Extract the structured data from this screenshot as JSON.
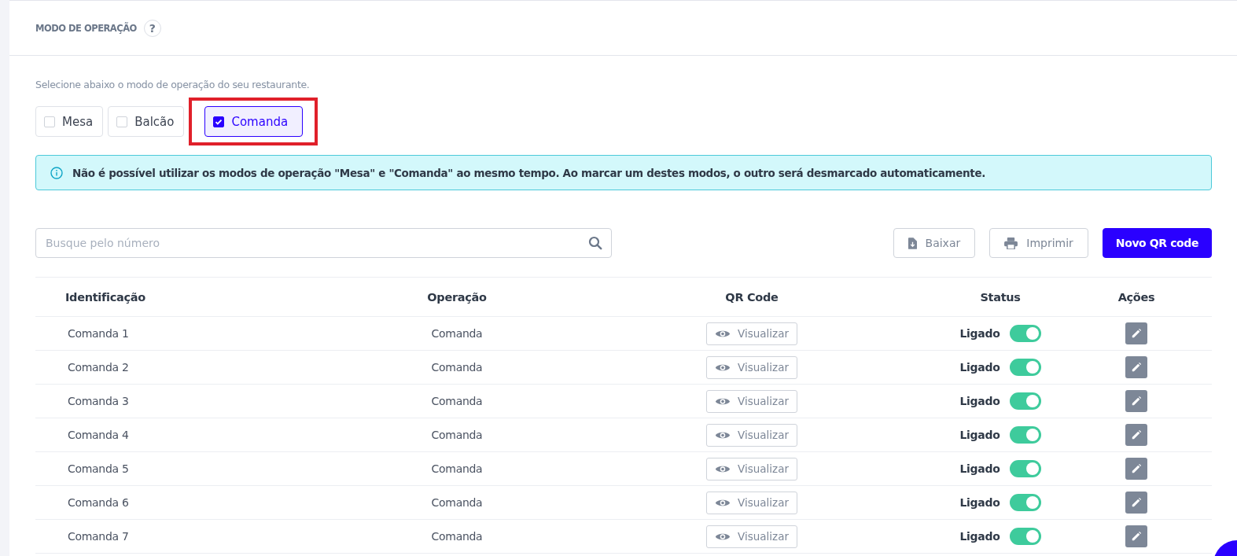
{
  "section": {
    "title": "MODO DE OPERAÇÃO",
    "help_icon": "?"
  },
  "instructions": "Selecione abaixo o modo de operação do seu restaurante.",
  "modes": [
    {
      "label": "Mesa",
      "checked": false,
      "highlighted": false
    },
    {
      "label": "Balcão",
      "checked": false,
      "highlighted": false
    },
    {
      "label": "Comanda",
      "checked": true,
      "highlighted": true
    }
  ],
  "alert": "Não é possível utilizar os modos de operação \"Mesa\" e \"Comanda\" ao mesmo tempo. Ao marcar um destes modos, o outro será desmarcado automaticamente.",
  "search": {
    "placeholder": "Busque pelo número"
  },
  "actions": [
    {
      "label": "Baixar",
      "kind": "download"
    },
    {
      "label": "Imprimir",
      "kind": "print"
    },
    {
      "label": "Novo QR code",
      "kind": "primary"
    }
  ],
  "table": {
    "columns": [
      "Identificação",
      "Operação",
      "QR Code",
      "Status",
      "Ações"
    ],
    "rows": [
      {
        "identification": "Comanda 1",
        "operation": "Comanda",
        "qr": "Visualizar",
        "status": "Ligado",
        "on": true
      },
      {
        "identification": "Comanda 2",
        "operation": "Comanda",
        "qr": "Visualizar",
        "status": "Ligado",
        "on": true
      },
      {
        "identification": "Comanda 3",
        "operation": "Comanda",
        "qr": "Visualizar",
        "status": "Ligado",
        "on": true
      },
      {
        "identification": "Comanda 4",
        "operation": "Comanda",
        "qr": "Visualizar",
        "status": "Ligado",
        "on": true
      },
      {
        "identification": "Comanda 5",
        "operation": "Comanda",
        "qr": "Visualizar",
        "status": "Ligado",
        "on": true
      },
      {
        "identification": "Comanda 6",
        "operation": "Comanda",
        "qr": "Visualizar",
        "status": "Ligado",
        "on": true
      },
      {
        "identification": "Comanda 7",
        "operation": "Comanda",
        "qr": "Visualizar",
        "status": "Ligado",
        "on": true
      }
    ]
  }
}
